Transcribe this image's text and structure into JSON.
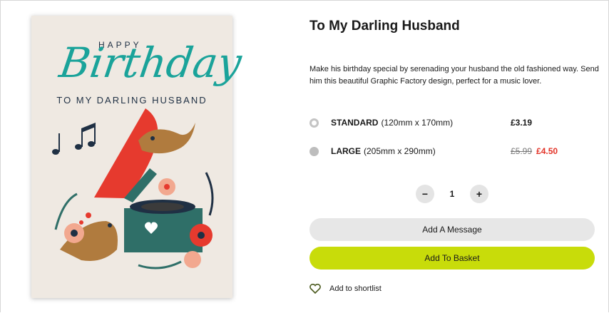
{
  "product": {
    "title": "To My Darling Husband",
    "description": "Make his birthday special by serenading your husband the old fashioned way. Send him this beautiful Graphic Factory design, perfect for a music lover."
  },
  "card_art": {
    "happy": "HAPPY",
    "birthday": "Birthday",
    "to_my": "TO MY DARLING HUSBAND"
  },
  "options": [
    {
      "name": "STANDARD",
      "size": "(120mm x 170mm)",
      "price": "£3.19",
      "selected": true
    },
    {
      "name": "LARGE",
      "size": "(205mm x 290mm)",
      "old_price": "£5.99",
      "price": "£4.50",
      "selected": false
    }
  ],
  "quantity": {
    "minus": "−",
    "value": "1",
    "plus": "+"
  },
  "buttons": {
    "message": "Add A Message",
    "basket": "Add To Basket"
  },
  "shortlist": {
    "label": "Add to shortlist",
    "icon": "heart-icon"
  },
  "colors": {
    "basket": "#c8dc0a",
    "sale": "#e33327",
    "teal": "#1aa39a"
  }
}
